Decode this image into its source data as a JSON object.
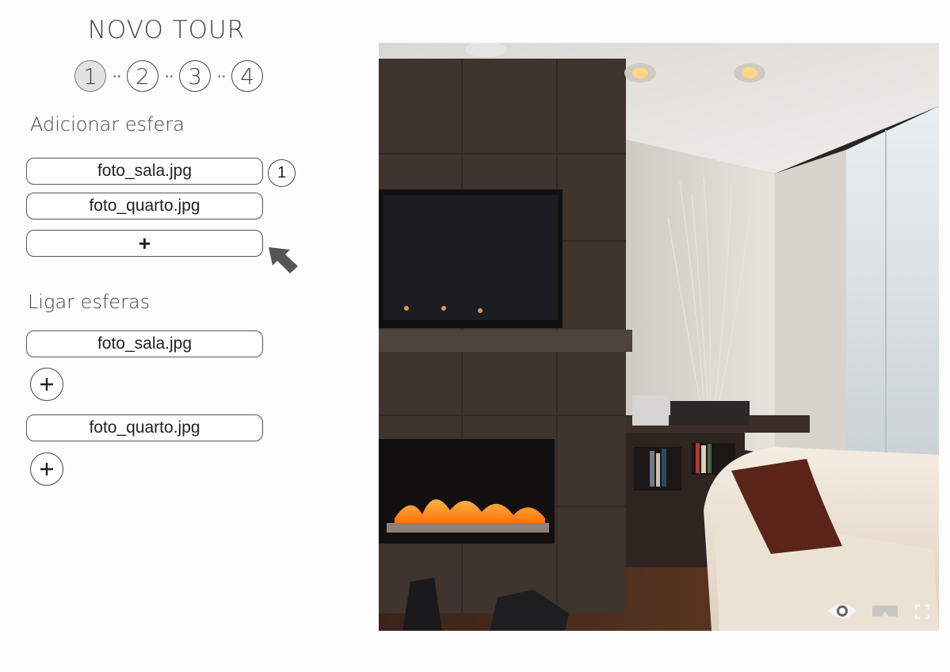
{
  "header": {
    "title": "NOVO TOUR",
    "steps": [
      "1",
      "2",
      "3",
      "4"
    ],
    "step_separator": "··",
    "active_step": 1
  },
  "add_sphere": {
    "title": "Adicionar esfera",
    "files": [
      "foto_sala.jpg",
      "foto_quarto.jpg"
    ],
    "add_label": "+",
    "count_badge": "1"
  },
  "link_spheres": {
    "title": "Ligar esferas",
    "groups": [
      {
        "file": "foto_sala.jpg"
      },
      {
        "file": "foto_quarto.jpg"
      }
    ]
  },
  "viewer": {
    "controls": [
      "eye-icon",
      "vr-headset-icon",
      "fullscreen-icon"
    ]
  }
}
